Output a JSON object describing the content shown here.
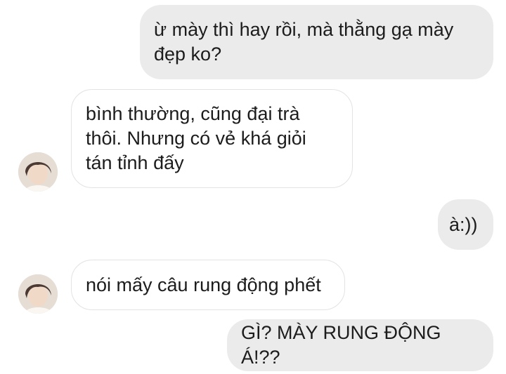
{
  "conversation": {
    "messages": [
      {
        "from": "me",
        "text": "ừ mày thì hay rồi, mà thằng gạ mày\nđẹp ko?"
      },
      {
        "from": "them",
        "text": "bình thường, cũng đại trà\nthôi. Nhưng có vẻ khá giỏi\ntán tỉnh đấy"
      },
      {
        "from": "me",
        "text": "à:))"
      },
      {
        "from": "them",
        "text": "nói mấy câu rung động phết"
      },
      {
        "from": "me",
        "text": "GÌ? MÀY RUNG ĐỘNG Á!??"
      }
    ]
  },
  "colors": {
    "outgoing_bubble": "#ebebeb",
    "incoming_bubble": "#ffffff",
    "incoming_border": "#e3e3e3",
    "text": "#1c1c1c"
  },
  "icons": {
    "avatar": "contact-avatar-photo"
  }
}
